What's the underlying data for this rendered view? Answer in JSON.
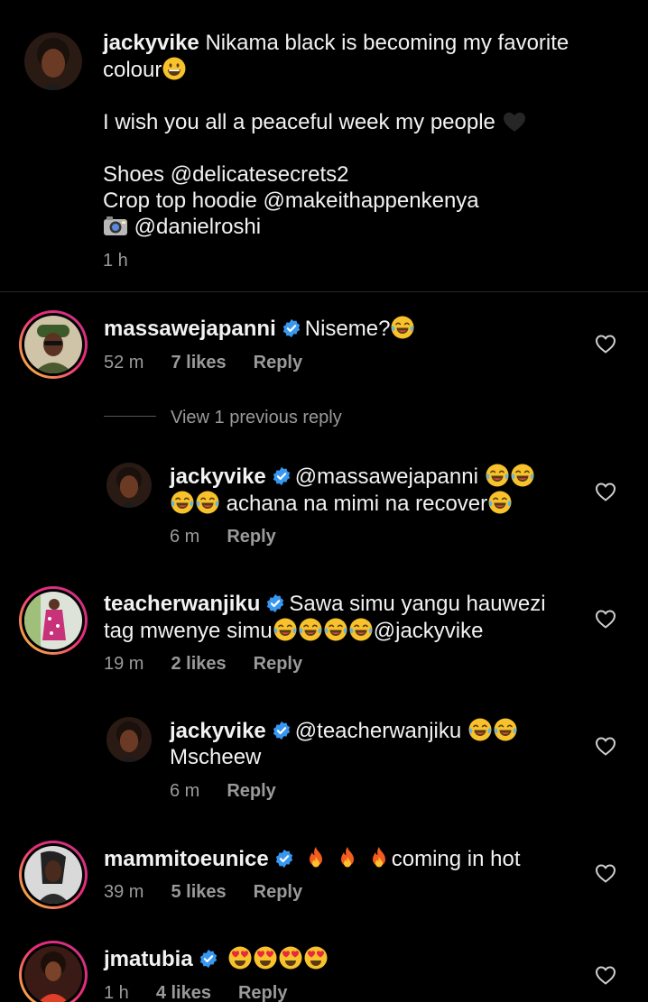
{
  "caption": {
    "username": "jackyvike",
    "line1": "Nikama black is becoming my favorite",
    "line2": "colour",
    "line3": "I wish you all a peaceful week my people",
    "line4": "Shoes @delicatesecrets2",
    "line5": "Crop top hoodie @makeithappenkenya",
    "line6": "@danielroshi",
    "time": "1 h"
  },
  "comments": [
    {
      "username": "massawejapanni",
      "text": "Niseme?",
      "time": "52 m",
      "likes": "7 likes",
      "reply": "Reply",
      "verified": true
    },
    {
      "username": "jackyvike",
      "text1": "@massawejapanni",
      "text2": "achana na mimi na recover",
      "time": "6 m",
      "reply": "Reply",
      "verified": true
    },
    {
      "username": "teacherwanjiku",
      "text1": "Sawa simu yangu hauwezi",
      "text2": "tag mwenye simu",
      "text3": "@jackyvike",
      "time": "19 m",
      "likes": "2 likes",
      "reply": "Reply",
      "verified": true
    },
    {
      "username": "jackyvike",
      "text1": "@teacherwanjiku",
      "text2": "Mscheew",
      "time": "6 m",
      "reply": "Reply",
      "verified": true
    },
    {
      "username": "mammitoeunice",
      "text": "coming in hot",
      "time": "39 m",
      "likes": "5 likes",
      "reply": "Reply",
      "verified": true
    },
    {
      "username": "jmatubia",
      "text": "",
      "time": "1 h",
      "likes": "4 likes",
      "reply": "Reply",
      "verified": true
    }
  ],
  "view_replies": "View 1 previous reply",
  "colors": {
    "background": "#000000",
    "text": "#f2f2f2",
    "meta": "#9a9a9a",
    "verified": "#3897f0"
  }
}
